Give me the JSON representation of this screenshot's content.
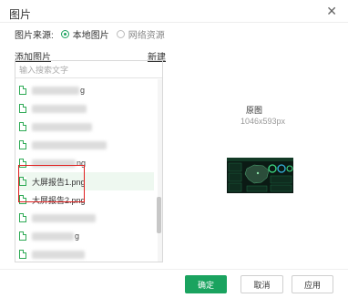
{
  "dialog": {
    "title": "图片",
    "close_label": "✕"
  },
  "source": {
    "label": "图片来源:",
    "options": [
      {
        "label": "本地图片",
        "checked": true
      },
      {
        "label": "网络资源",
        "checked": false
      }
    ]
  },
  "list_header": {
    "add_label": "添加图片",
    "new_label": "新建"
  },
  "search": {
    "placeholder": "输入搜索文字"
  },
  "files": [
    {
      "name": "",
      "suffix": "g"
    },
    {
      "name": "",
      "suffix": ""
    },
    {
      "name": "",
      "suffix": ""
    },
    {
      "name": "",
      "suffix": ""
    },
    {
      "name": "",
      "suffix": "ng"
    },
    {
      "name": "大屏报告1.png",
      "suffix": ""
    },
    {
      "name": "大屏报告2.png",
      "suffix": ""
    },
    {
      "name": "",
      "suffix": ""
    },
    {
      "name": "",
      "suffix": "g"
    },
    {
      "name": "",
      "suffix": ""
    },
    {
      "name": "",
      "suffix": ""
    }
  ],
  "preview": {
    "name": "原图",
    "dimensions": "1046x593px"
  },
  "buttons": {
    "ok": "确定",
    "cancel": "取消",
    "apply": "应用"
  },
  "colors": {
    "accent": "#1aa35f",
    "highlight_border": "#e02020"
  }
}
